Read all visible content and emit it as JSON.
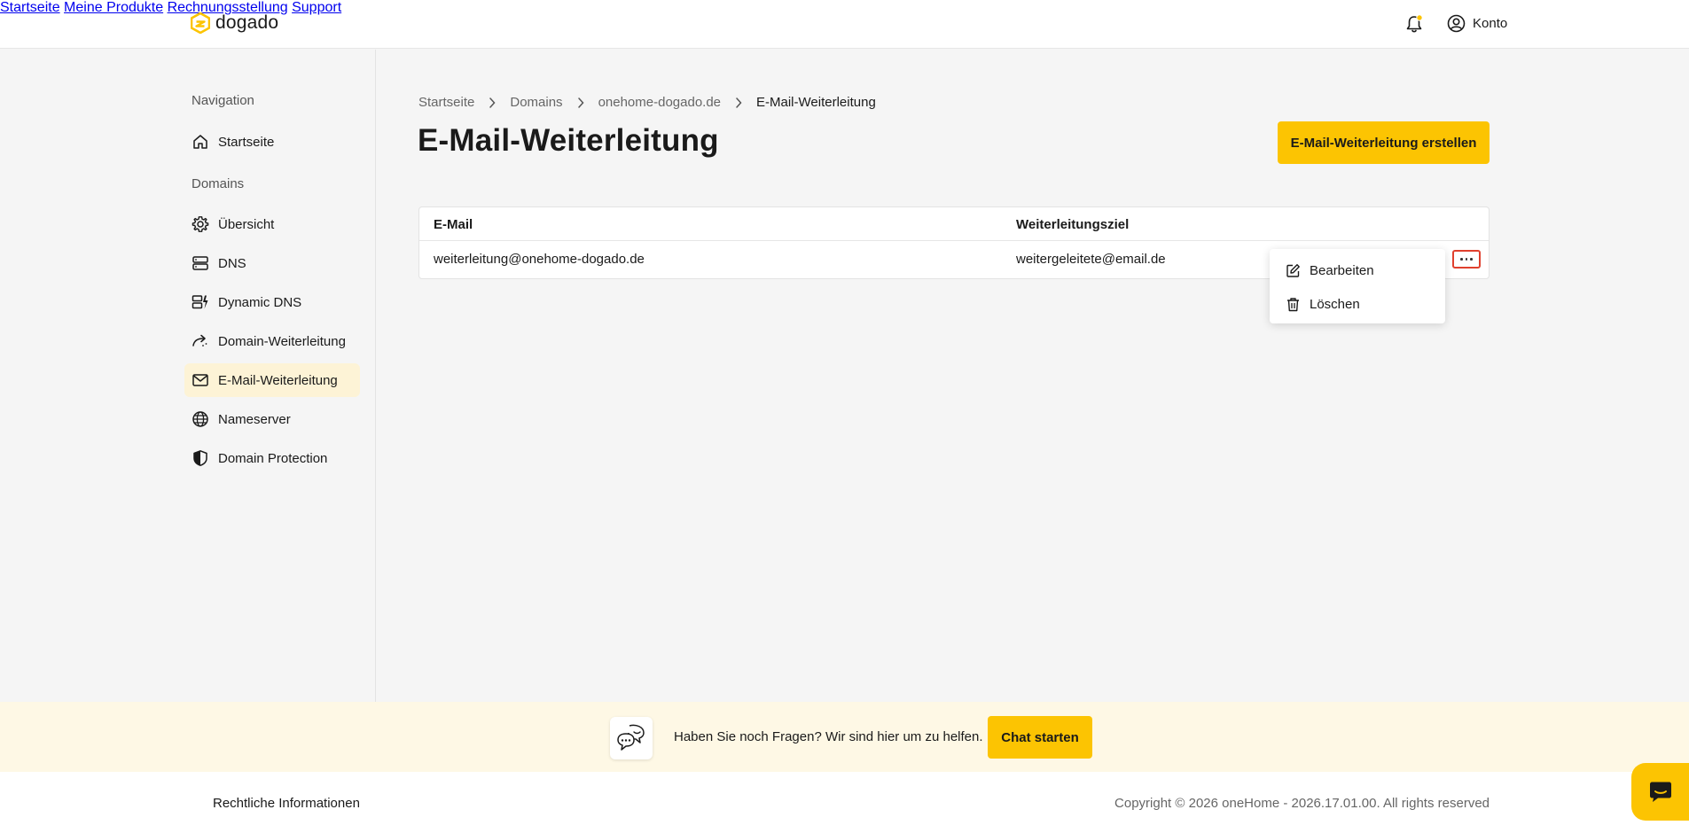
{
  "brand": {
    "name": "dogado",
    "accent": "#fcc402"
  },
  "topnav": {
    "items": [
      "Startseite",
      "Meine Produkte",
      "Rechnungsstellung",
      "Support"
    ],
    "account_label": "Konto"
  },
  "sidebar": {
    "heading_navigation": "Navigation",
    "home_label": "Startseite",
    "heading_domains": "Domains",
    "items": [
      {
        "label": "Übersicht",
        "icon": "gear-icon"
      },
      {
        "label": "DNS",
        "icon": "server-icon"
      },
      {
        "label": "Dynamic DNS",
        "icon": "dynamic-dns-icon"
      },
      {
        "label": "Domain-Weiterleitung",
        "icon": "forward-arrow-icon"
      },
      {
        "label": "E-Mail-Weiterleitung",
        "icon": "mail-icon",
        "active": true
      },
      {
        "label": "Nameserver",
        "icon": "globe-icon"
      },
      {
        "label": "Domain Protection",
        "icon": "shield-icon"
      }
    ]
  },
  "breadcrumb": [
    "Startseite",
    "Domains",
    "onehome-dogado.de",
    "E-Mail-Weiterleitung"
  ],
  "page": {
    "title": "E-Mail-Weiterleitung",
    "create_button": "E-Mail-Weiterleitung erstellen"
  },
  "table": {
    "columns": [
      "E-Mail",
      "Weiterleitungsziel"
    ],
    "rows": [
      {
        "email": "weiterleitung@onehome-dogado.de",
        "target": "weitergeleitete@email.de"
      }
    ]
  },
  "row_menu": {
    "items": [
      "Bearbeiten",
      "Löschen"
    ]
  },
  "help": {
    "text": "Haben Sie noch Fragen? Wir sind hier um zu helfen.",
    "button": "Chat starten"
  },
  "footer": {
    "link": "Rechtliche Informationen",
    "copyright": "Copyright © 2026 oneHome - 2026.17.01.00. All rights reserved"
  }
}
